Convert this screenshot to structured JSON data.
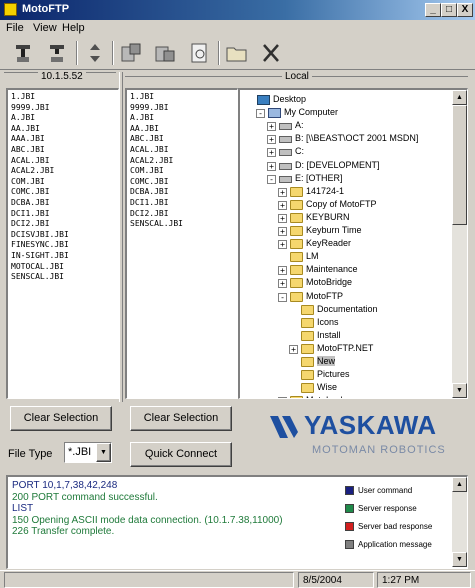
{
  "window": {
    "title": "MotoFTP",
    "controls": {
      "minimize": "_",
      "maximize": "□",
      "close": "X"
    }
  },
  "menu": {
    "items": [
      "File",
      "View",
      "Help"
    ]
  },
  "toolbar": {
    "buttons": [
      {
        "name": "connect-icon"
      },
      {
        "name": "disconnect-icon"
      },
      {
        "name": "transfer-icon"
      },
      {
        "name": "upload-icon"
      },
      {
        "name": "download-icon"
      },
      {
        "name": "view-file-icon"
      },
      {
        "name": "open-folder-icon"
      },
      {
        "name": "delete-icon"
      }
    ]
  },
  "remote": {
    "header": "10.1.5.52",
    "files_left": [
      "1.JBI",
      "9999.JBI",
      "A.JBI",
      "AA.JBI",
      "AAA.JBI",
      "ABC.JBI",
      "ACAL.JBI",
      "ACAL2.JBI",
      "COM.JBI",
      "COMC.JBI",
      "DCBA.JBI",
      "DCI1.JBI",
      "DCI2.JBI",
      "DCISVJBI.JBI",
      "FINESYNC.JBI",
      "IN-SIGHT.JBI",
      "MOTOCAL.JBI",
      "SENSCAL.JBI"
    ]
  },
  "local": {
    "header": "Local",
    "files": [
      "1.JBI",
      "9999.JBI",
      "A.JBI",
      "AA.JBI",
      "ABC.JBI",
      "ACAL.JBI",
      "ACAL2.JBI",
      "COM.JBI",
      "COMC.JBI",
      "DCBA.JBI",
      "DCI1.JBI",
      "DCI2.JBI",
      "SENSCAL.JBI"
    ],
    "tree": [
      {
        "label": "Desktop",
        "icon": "desktop",
        "expander": ""
      },
      {
        "label": "My Computer",
        "icon": "computer",
        "expander": "-"
      },
      {
        "label": "A:",
        "icon": "drive",
        "expander": "+"
      },
      {
        "label": "B: [\\\\BEAST\\OCT 2001 MSDN]",
        "icon": "drive",
        "expander": "+"
      },
      {
        "label": "C:",
        "icon": "drive",
        "expander": "+"
      },
      {
        "label": "D: [DEVELOPMENT]",
        "icon": "drive",
        "expander": "+"
      },
      {
        "label": "E: [OTHER]",
        "icon": "drive",
        "expander": "-"
      },
      {
        "label": "141724-1",
        "icon": "folder",
        "expander": "+"
      },
      {
        "label": "Copy of MotoFTP",
        "icon": "folder",
        "expander": "+"
      },
      {
        "label": "KEYBURN",
        "icon": "folder",
        "expander": "+"
      },
      {
        "label": "Keyburn Time",
        "icon": "folder",
        "expander": "+"
      },
      {
        "label": "KeyReader",
        "icon": "folder",
        "expander": "+"
      },
      {
        "label": "LM",
        "icon": "folder",
        "expander": ""
      },
      {
        "label": "Maintenance",
        "icon": "folder",
        "expander": "+"
      },
      {
        "label": "MotoBridge",
        "icon": "folder",
        "expander": "+"
      },
      {
        "label": "MotoFTP",
        "icon": "folder",
        "expander": "-"
      },
      {
        "label": "Documentation",
        "icon": "folder",
        "expander": ""
      },
      {
        "label": "Icons",
        "icon": "folder",
        "expander": ""
      },
      {
        "label": "Install",
        "icon": "folder",
        "expander": ""
      },
      {
        "label": "MotoFTP.NET",
        "icon": "folder",
        "expander": "+"
      },
      {
        "label": "New",
        "icon": "folder",
        "expander": ""
      },
      {
        "label": "Pictures",
        "icon": "folder",
        "expander": ""
      },
      {
        "label": "Wise",
        "icon": "folder",
        "expander": ""
      },
      {
        "label": "MotoLock",
        "icon": "folder",
        "expander": "+"
      }
    ]
  },
  "buttons": {
    "clear_remote": "Clear Selection",
    "clear_local": "Clear Selection",
    "quick_connect": "Quick Connect"
  },
  "file_type": {
    "label": "File Type",
    "value": "*.JBI"
  },
  "brand": {
    "name": "YASKAWA",
    "sub": "MOTOMAN ROBOTICS",
    "color": "#1e4fa0",
    "sub_color": "#7a8aa6"
  },
  "log": {
    "lines": [
      {
        "text": "PORT 10,1,7,38,42,248",
        "color": "#1a2a80"
      },
      {
        "text": "200 PORT command successful.",
        "color": "#1f7a3a"
      },
      {
        "text": "LIST",
        "color": "#1a2a80"
      },
      {
        "text": "150 Opening ASCII mode data connection. (10.1.7.38,11000)",
        "color": "#1f7a3a"
      },
      {
        "text": "226 Transfer complete.",
        "color": "#1f7a3a"
      }
    ]
  },
  "legend": [
    {
      "label": "User command",
      "color": "#1a2080"
    },
    {
      "label": "Server response",
      "color": "#1f8a4a"
    },
    {
      "label": "Server bad response",
      "color": "#d21f1f"
    },
    {
      "label": "Application message",
      "color": "#808080"
    }
  ],
  "status": {
    "date": "8/5/2004",
    "time": "1:27 PM"
  }
}
